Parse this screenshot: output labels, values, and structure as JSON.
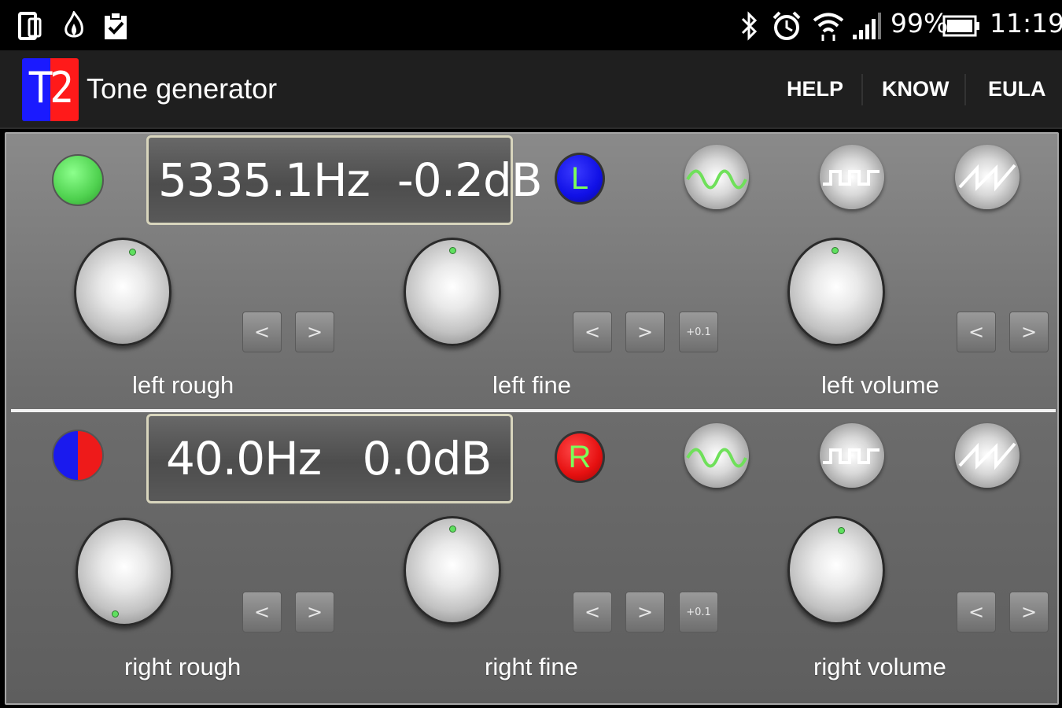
{
  "status_bar": {
    "battery_percent": "99%",
    "time": "11:19",
    "left_icons": [
      "phone-outline-icon",
      "flame-icon",
      "clipboard-check-icon"
    ],
    "right_icons": [
      "bluetooth-icon",
      "alarm-icon",
      "wifi-icon",
      "signal-icon",
      "battery-icon"
    ]
  },
  "app_bar": {
    "logo_text": "T2",
    "title": "Tone generator",
    "menu": [
      "HELP",
      "KNOW",
      "EULA"
    ]
  },
  "colors": {
    "led_green": "#5fe05f",
    "badge_left_blue": "#1010e6",
    "badge_right_red": "#e61010",
    "badge_text_green": "#7cff5a"
  },
  "left": {
    "display": "5335.1Hz  -0.2dB",
    "channel_letter": "L",
    "rough_label": "left rough",
    "fine_label": "left fine",
    "volume_label": "left volume",
    "fine_step_label": "+0.1"
  },
  "right": {
    "display": "40.0Hz   0.0dB",
    "channel_letter": "R",
    "rough_label": "right rough",
    "fine_label": "right fine",
    "volume_label": "right volume",
    "fine_step_label": "+0.1"
  },
  "step_buttons": {
    "decrease": "<",
    "increase": ">"
  }
}
